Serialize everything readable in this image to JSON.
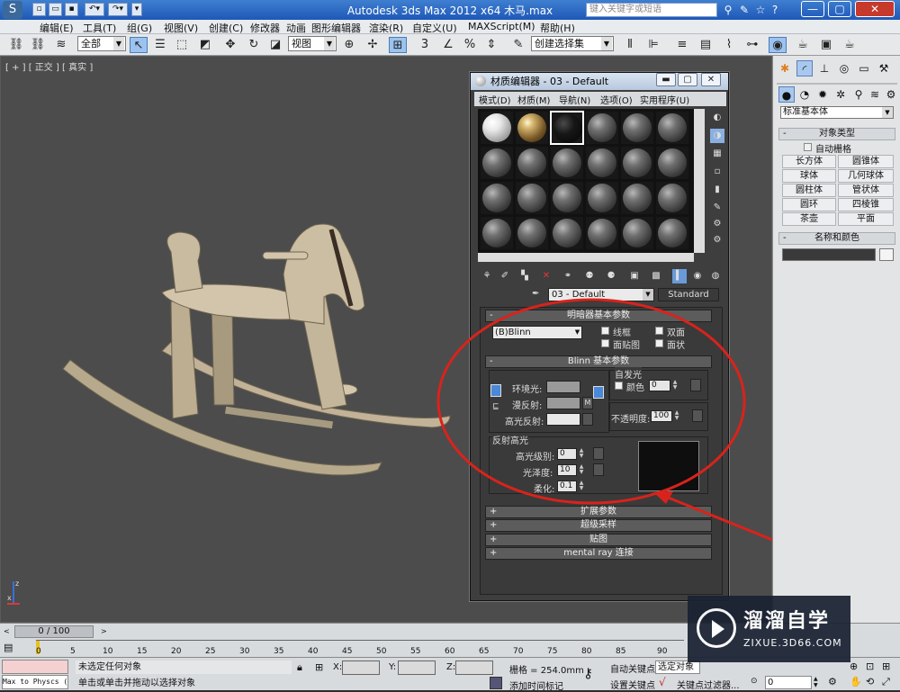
{
  "window": {
    "title": "Autodesk 3ds Max  2012 x64      木马.max",
    "search_placeholder": "键入关键字或短语"
  },
  "menubar": [
    "编辑(E)",
    "工具(T)",
    "组(G)",
    "视图(V)",
    "创建(C)",
    "修改器",
    "动画",
    "图形编辑器",
    "渲染(R)",
    "自定义(U)",
    "MAXScript(M)",
    "帮助(H)"
  ],
  "main_toolbar": {
    "selection_filter": "全部",
    "reference_coord": "视图",
    "named_selection": "创建选择集"
  },
  "viewport": {
    "label": "[ + ] [ 正交 ] [ 真实 ]",
    "axis_x": "x",
    "axis_z": "z"
  },
  "material_editor": {
    "title": "材质编辑器 - 03 - Default",
    "menu": [
      "模式(D)",
      "材质(M)",
      "导航(N)",
      "选项(O)",
      "实用程序(U)"
    ],
    "material_name": "03 - Default",
    "material_type": "Standard",
    "shader_rollout": {
      "header": "明暗器基本参数",
      "shader": "(B)Blinn",
      "checks": [
        "线框",
        "双面",
        "面贴图",
        "面状"
      ]
    },
    "blinn_rollout": {
      "header": "Blinn 基本参数",
      "ambient": "环境光:",
      "diffuse": "漫反射:",
      "specular": "高光反射:",
      "self_illum_group": "自发光",
      "self_illum_color": "颜色",
      "self_illum_value": "0",
      "opacity_label": "不透明度:",
      "opacity_value": "100",
      "m_label": "M",
      "spec_group": "反射高光",
      "spec_level_label": "高光级别:",
      "spec_level": "0",
      "gloss_label": "光泽度:",
      "gloss": "10",
      "soften_label": "柔化:",
      "soften": "0.1"
    },
    "collapsed_rollouts": [
      "扩展参数",
      "超级采样",
      "贴图",
      "mental ray 连接"
    ]
  },
  "command_panel": {
    "category": "标准基本体",
    "object_type_header": "对象类型",
    "autogrid": "自动栅格",
    "objects": [
      "长方体",
      "圆锥体",
      "球体",
      "几何球体",
      "圆柱体",
      "管状体",
      "圆环",
      "四棱锥",
      "茶壶",
      "平面"
    ],
    "name_color_header": "名称和颜色"
  },
  "timeline": {
    "frame_display": "0 / 100",
    "ticks": [
      "0",
      "5",
      "10",
      "15",
      "20",
      "25",
      "30",
      "35",
      "40",
      "45",
      "50",
      "55",
      "60",
      "65",
      "70",
      "75",
      "80",
      "85",
      "90"
    ]
  },
  "statusbar": {
    "script_listener": "Max to Physcs (",
    "selection_status": "未选定任何对象",
    "prompt": "单击或单击并拖动以选择对象",
    "x_label": "X:",
    "y_label": "Y:",
    "z_label": "Z:",
    "grid": "栅格 = 254.0mm",
    "add_time_tag": "添加时间标记",
    "auto_key": "自动关键点",
    "selected": "选定对象",
    "set_key": "设置关键点",
    "key_filters": "关键点过滤器...",
    "frame": "0"
  },
  "watermark": {
    "brand": "溜溜自学",
    "url": "ZIXUE.3D66.COM"
  },
  "colors": {
    "annotation_red": "#d8231c",
    "title_blue": "#1e58b8",
    "horse_wood": "#c9bba0"
  }
}
